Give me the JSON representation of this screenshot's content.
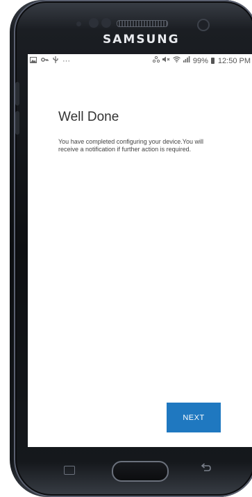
{
  "device": {
    "brand": "SAMSUNG"
  },
  "statusbar": {
    "left_icons": [
      "image-icon",
      "key-icon",
      "usb-icon",
      "more-icon"
    ],
    "more_text": "···",
    "battery_percent": "99%",
    "time": "12:50 PM"
  },
  "page": {
    "title": "Well Done",
    "description": "You have completed configuring your device.You will receive a notification if further action is required."
  },
  "actions": {
    "next_label": "NEXT"
  },
  "colors": {
    "accent": "#1f78c0",
    "background": "#ffffff"
  }
}
